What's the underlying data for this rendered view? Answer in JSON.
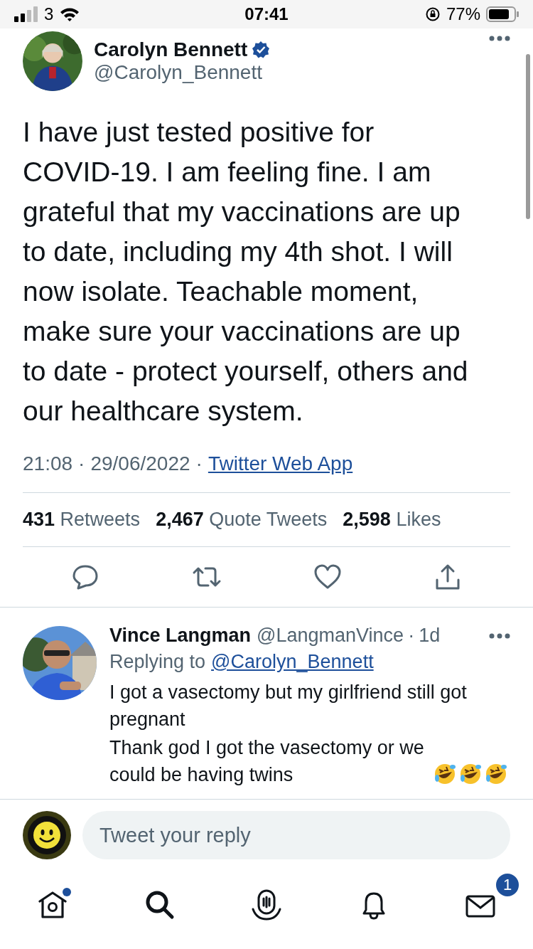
{
  "status_bar": {
    "carrier": "3",
    "time": "07:41",
    "battery": "77%"
  },
  "tweet": {
    "author": {
      "name": "Carolyn Bennett",
      "handle": "@Carolyn_Bennett",
      "verified": true
    },
    "text": "I have just tested positive for COVID-19. I am feeling fine. I am grateful that my vaccinations are up to date, including my 4th shot. I will now isolate. Teachable moment, make sure your vaccinations are up to date - protect yourself, others and our healthcare system.",
    "time": "21:08",
    "separator": "·",
    "date": "29/06/2022",
    "source": "Twitter Web App",
    "stats": [
      "**431** Retweets",
      "**2,467** Quote Tweets",
      "**2,598** Likes"
    ]
  },
  "reply": {
    "name": "Vince Langman",
    "handle": "@LangmanVince",
    "separator": "·",
    "age": "1d",
    "replying_label": "Replying to",
    "replying_to": "@Carolyn_Bennett",
    "paragraphs": [
      "I got a vasectomy but my girlfriend still got pregnant",
      "Thank god I got the vasectomy or we could be having twins"
    ],
    "emoji": [
      {
        "kind": "rolling-laughing"
      },
      {
        "kind": "rolling-laughing"
      },
      {
        "kind": "rolling-laughing"
      }
    ]
  },
  "composer": {
    "placeholder": "Tweet your reply"
  },
  "tab_bar": {
    "home_unread": true,
    "messages_badge": "1"
  }
}
